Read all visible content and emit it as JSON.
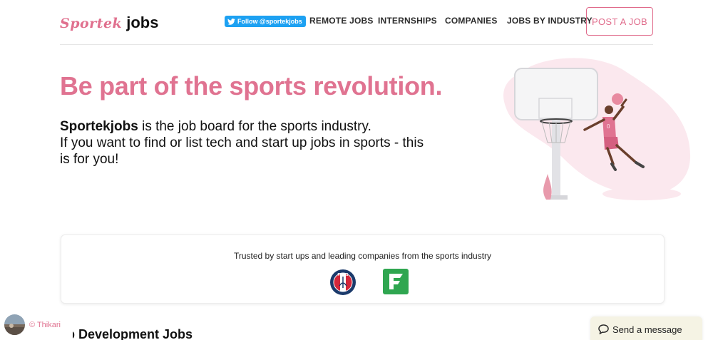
{
  "header": {
    "logo_brand": "Sportek",
    "logo_suffix": "jobs",
    "twitter_label": "Follow @sportekjobs",
    "nav": {
      "remote": "REMOTE JOBS",
      "internships": "INTERNSHIPS",
      "companies": "COMPANIES",
      "industry": "JOBS BY INDUSTRY"
    },
    "post_job": "POST A JOB"
  },
  "hero": {
    "title": "Be part of the sports revolution.",
    "brand_bold": "Sportekjobs",
    "line1_rest": " is the job board for the sports industry.",
    "line2": "If you want to find or list tech and start up jobs in sports - this is for you!",
    "jersey_number": "0"
  },
  "trusted": {
    "text": "Trusted by start ups and leading companies from the sports industry",
    "psg_label": "PARIS"
  },
  "jobs_section": {
    "title": "eb Development Jobs"
  },
  "credit": {
    "text": "© Thikari"
  },
  "chat": {
    "label": "Send a message"
  },
  "colors": {
    "brand_pink": "#e07391",
    "twitter_blue": "#1da1f2",
    "psg_navy": "#1b3a6b",
    "partner_green": "#2fa650"
  }
}
